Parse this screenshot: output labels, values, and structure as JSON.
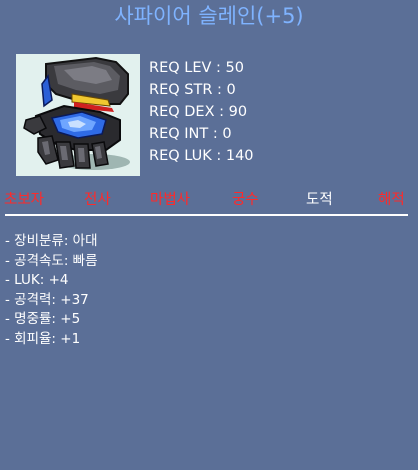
{
  "item": {
    "title": "사파이어 슬레인(+5)",
    "icon": "sapphire-slain-glove-icon"
  },
  "requirements": [
    "REQ LEV : 50",
    "REQ STR : 0",
    "REQ DEX : 90",
    "REQ INT : 0",
    "REQ LUK : 140"
  ],
  "jobs": [
    {
      "label": "초보자",
      "allowed": false
    },
    {
      "label": "전사",
      "allowed": false
    },
    {
      "label": "마법사",
      "allowed": false
    },
    {
      "label": "궁수",
      "allowed": false
    },
    {
      "label": "도적",
      "allowed": true
    },
    {
      "label": "해적",
      "allowed": false
    }
  ],
  "stats": [
    "- 장비분류: 아대",
    "- 공격속도: 빠름",
    "- LUK: +4",
    "- 공격력: +37",
    "- 명중률: +5",
    "- 회피율: +1"
  ],
  "colors": {
    "background": "#5b6f97",
    "title": "#7fb3ff",
    "job_disallowed": "#ff2a2a",
    "job_allowed": "#ffffff"
  }
}
